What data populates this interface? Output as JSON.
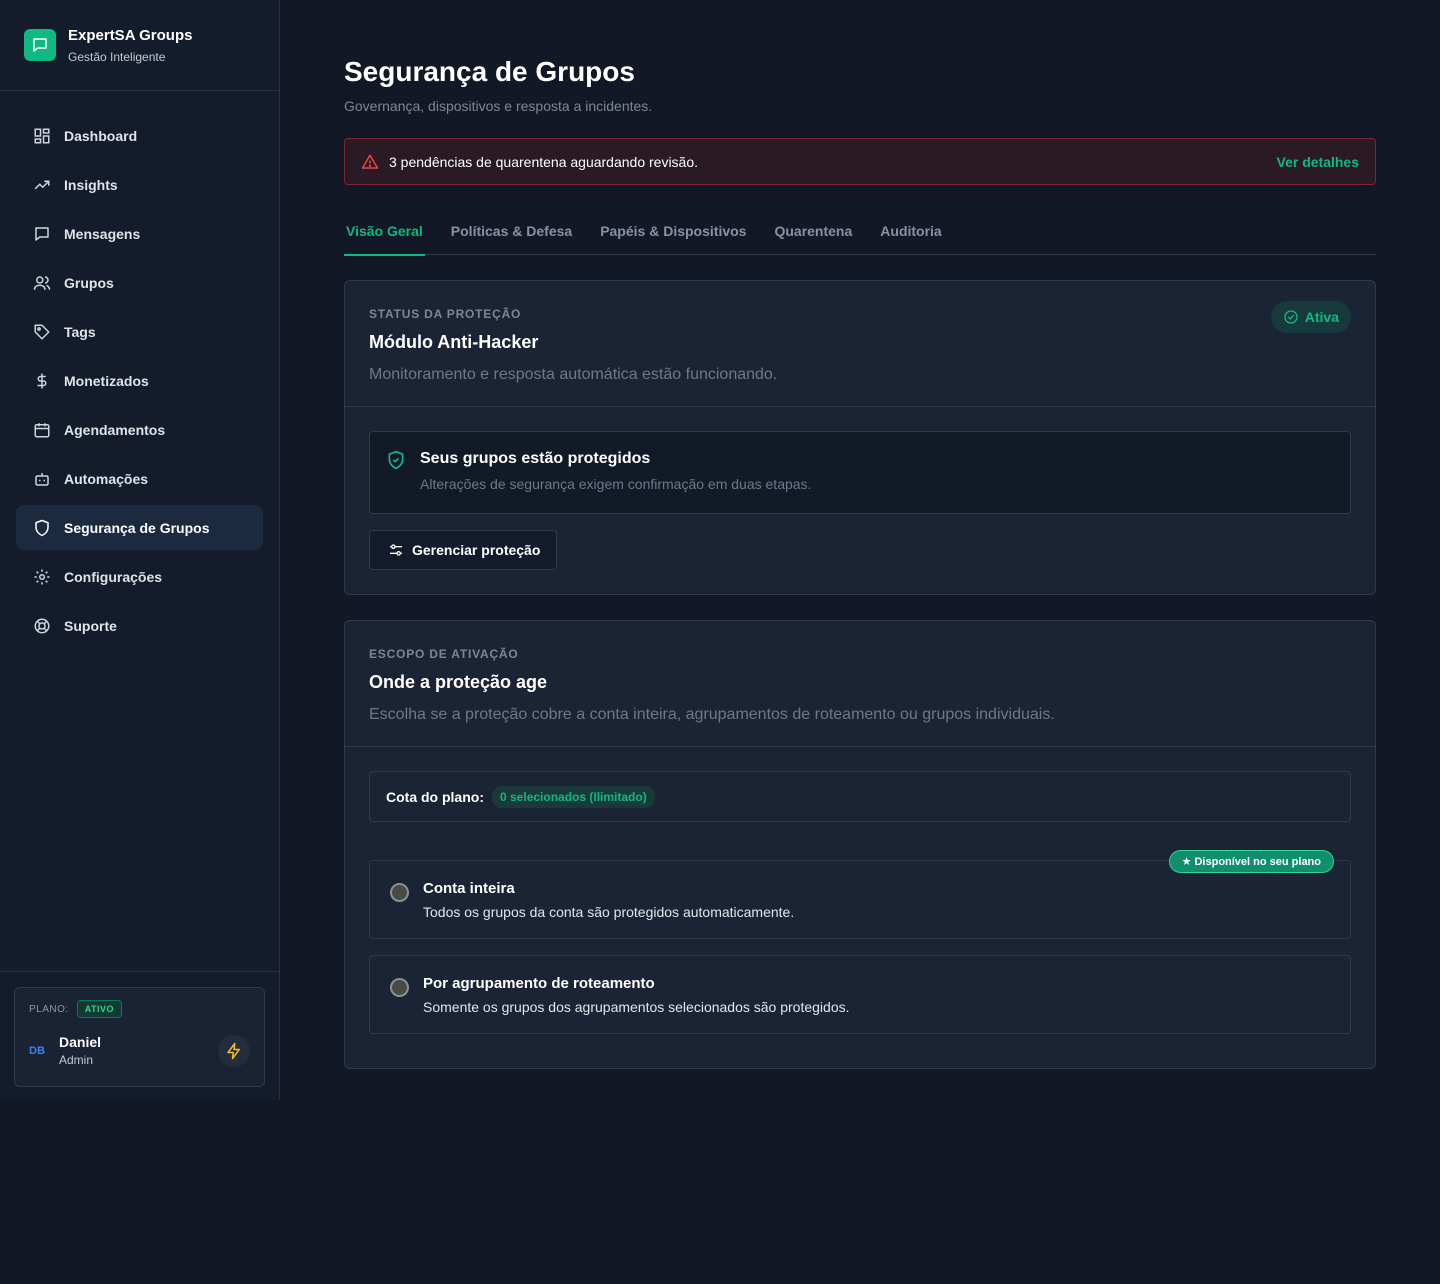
{
  "brand": {
    "title": "ExpertSA Groups",
    "subtitle": "Gestão Inteligente",
    "accent": "#10b981"
  },
  "sidebar": {
    "items": [
      {
        "label": "Dashboard",
        "icon": "dashboard-icon"
      },
      {
        "label": "Insights",
        "icon": "trending-up-icon"
      },
      {
        "label": "Mensagens",
        "icon": "message-icon"
      },
      {
        "label": "Grupos",
        "icon": "users-icon"
      },
      {
        "label": "Tags",
        "icon": "tag-icon"
      },
      {
        "label": "Monetizados",
        "icon": "dollar-icon"
      },
      {
        "label": "Agendamentos",
        "icon": "calendar-icon"
      },
      {
        "label": "Automações",
        "icon": "bot-icon"
      },
      {
        "label": "Segurança de Grupos",
        "icon": "shield-icon",
        "active": true
      },
      {
        "label": "Configurações",
        "icon": "gear-icon"
      },
      {
        "label": "Suporte",
        "icon": "lifebuoy-icon"
      }
    ]
  },
  "plan": {
    "label": "PLANO:",
    "status": "ATIVO"
  },
  "user": {
    "initials": "DB",
    "name": "Daniel",
    "role": "Admin"
  },
  "page": {
    "title": "Segurança de Grupos",
    "subtitle": "Governança, dispositivos e resposta a incidentes."
  },
  "alert": {
    "text": "3 pendências de quarentena aguardando revisão.",
    "link": "Ver detalhes",
    "color": "#ef4444"
  },
  "tabs": [
    {
      "label": "Visão Geral",
      "active": true
    },
    {
      "label": "Políticas & Defesa"
    },
    {
      "label": "Papéis & Dispositivos"
    },
    {
      "label": "Quarentena"
    },
    {
      "label": "Auditoria"
    }
  ],
  "status_card": {
    "eyebrow": "STATUS DA PROTEÇÃO",
    "title": "Módulo Anti-Hacker",
    "description": "Monitoramento e resposta automática estão funcionando.",
    "status": "Ativa",
    "notice_title": "Seus grupos estão protegidos",
    "notice_desc": "Alterações de segurança exigem confirmação em duas etapas.",
    "button": "Gerenciar proteção"
  },
  "scope_card": {
    "eyebrow": "ESCOPO DE ATIVAÇÃO",
    "title": "Onde a proteção age",
    "description": "Escolha se a proteção cobre a conta inteira, agrupamentos de roteamento ou grupos individuais.",
    "quota_label": "Cota do plano:",
    "quota_value": "0 selecionados (Ilimitado)",
    "plan_flag": "★ Disponível no seu plano",
    "options": [
      {
        "title": "Conta inteira",
        "desc": "Todos os grupos da conta são protegidos automaticamente."
      },
      {
        "title": "Por agrupamento de roteamento",
        "desc": "Somente os grupos dos agrupamentos selecionados são protegidos."
      }
    ]
  }
}
